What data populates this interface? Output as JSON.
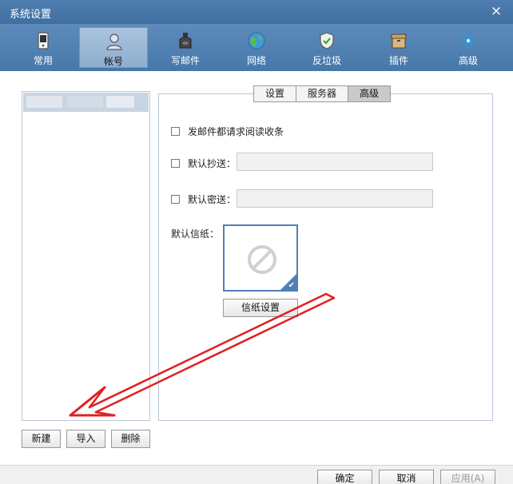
{
  "window": {
    "title": "系统设置",
    "close_glyph": "×"
  },
  "toolbar": {
    "items": [
      {
        "label": "常用",
        "icon": "phone-icon"
      },
      {
        "label": "帐号",
        "icon": "user-icon",
        "active": true
      },
      {
        "label": "写邮件",
        "icon": "ink-bottle-icon"
      },
      {
        "label": "网络",
        "icon": "globe-icon"
      },
      {
        "label": "反垃圾",
        "icon": "shield-check-icon"
      },
      {
        "label": "插件",
        "icon": "box-icon"
      },
      {
        "label": "高级",
        "icon": "gear-icon"
      }
    ]
  },
  "tabs": [
    {
      "label": "设置"
    },
    {
      "label": "服务器"
    },
    {
      "label": "高级",
      "active": true
    }
  ],
  "advanced": {
    "read_receipt_label": "发邮件都请求阅读收条",
    "cc_label": "默认抄送：",
    "cc_value": "",
    "bcc_label": "默认密送：",
    "bcc_value": "",
    "stationery_label": "默认信纸：",
    "stationery_button": "信纸设置"
  },
  "account_actions": {
    "new": "新建",
    "import": "导入",
    "delete": "删除"
  },
  "footer": {
    "ok": "确定",
    "cancel": "取消",
    "apply": "应用(A)"
  },
  "colors": {
    "titlebar": "#4f7fb0",
    "toolbar": "#4678a9",
    "annotation_arrow": "#e02020",
    "stationery_border": "#4e7fb5"
  }
}
